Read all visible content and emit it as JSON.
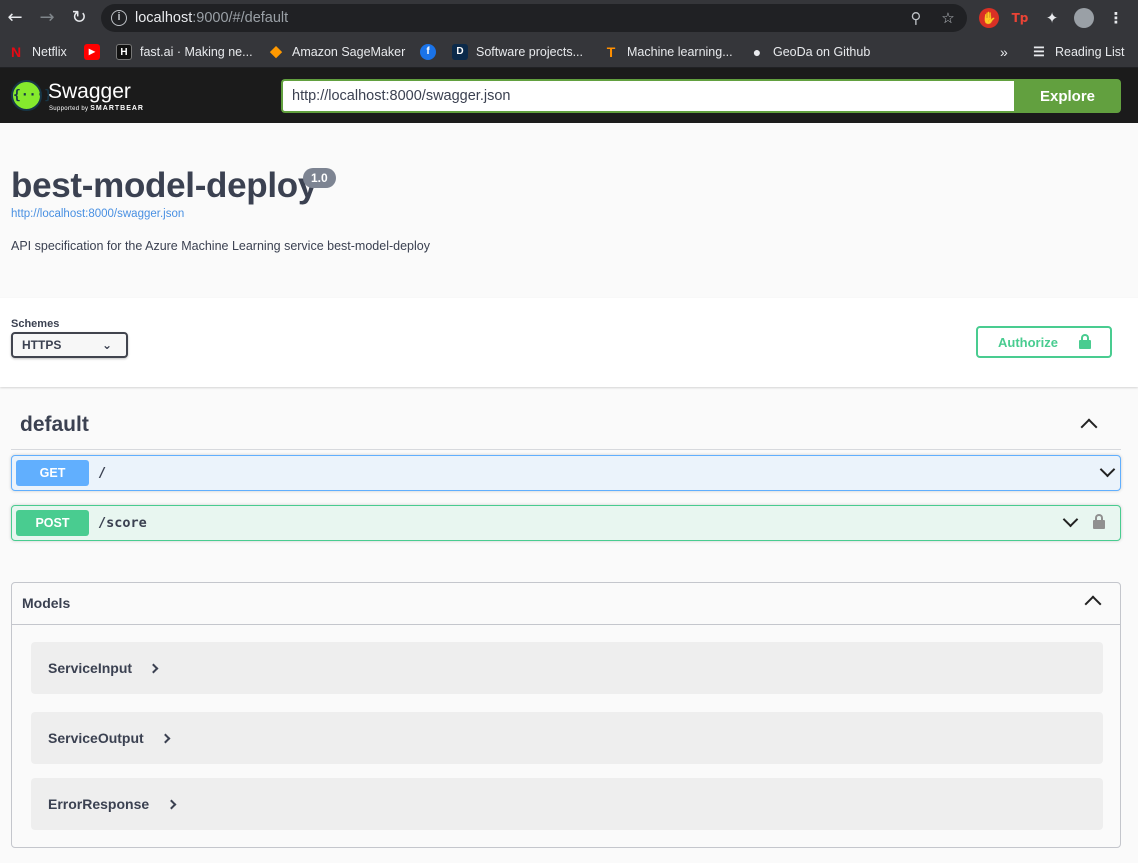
{
  "browser": {
    "url_host": "localhost",
    "url_rest": ":9000/#/default",
    "bookmarks": [
      {
        "label": "Netflix",
        "fav": "N",
        "color": "#e50914"
      },
      {
        "label": "",
        "fav": "▶",
        "color": "#ff0000"
      },
      {
        "label": "fast.ai · Making ne...",
        "fav": "H",
        "color": "#111111"
      },
      {
        "label": "Amazon SageMaker",
        "fav": "◆",
        "color": "#ff9900"
      },
      {
        "label": "",
        "fav": "f",
        "color": "#1a73e8"
      },
      {
        "label": "Software projects...",
        "fav": "D",
        "color": "#0b2a4a"
      },
      {
        "label": "Machine learning...",
        "fav": "T",
        "color": "#ff8f00"
      },
      {
        "label": "GeoDa on Github",
        "fav": "●",
        "color": "#5f6368"
      }
    ],
    "more": "»",
    "reading_list": "Reading List"
  },
  "topbar": {
    "logo": "Swagger",
    "logo_mark": "{···}",
    "supported_by": "Supported by",
    "smartbear": "SMARTBEAR",
    "spec_url": "http://localhost:8000/swagger.json",
    "explore": "Explore"
  },
  "info": {
    "title": "best-model-deploy",
    "version": "1.0",
    "url": "http://localhost:8000/swagger.json",
    "description": "API specification for the Azure Machine Learning service best-model-deploy"
  },
  "schemes": {
    "label": "Schemes",
    "selected": "HTTPS",
    "authorize": "Authorize"
  },
  "tag": {
    "name": "default",
    "operations": [
      {
        "method": "GET",
        "path": "/"
      },
      {
        "method": "POST",
        "path": "/score"
      }
    ]
  },
  "models": {
    "title": "Models",
    "items": [
      "ServiceInput",
      "ServiceOutput",
      "ErrorResponse"
    ]
  }
}
